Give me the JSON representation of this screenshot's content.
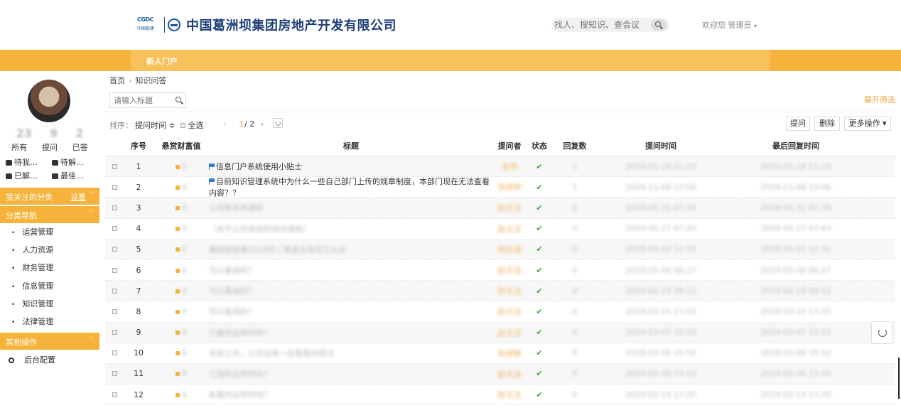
{
  "header": {
    "logo_top": "CGDC",
    "logo_bottom": "中国能建",
    "company": "中国葛洲坝集团房地产开发有限公司",
    "search_placeholder": "找人、搜知识、查会议",
    "welcome": "欢迎您 管理员",
    "caret": "▾"
  },
  "nav": {
    "tab": "新人门户"
  },
  "sidebar": {
    "stats": [
      {
        "num": "23",
        "label": "所有"
      },
      {
        "num": "9",
        "label": "提问"
      },
      {
        "num": "2",
        "label": "已答"
      }
    ],
    "quick": [
      "待我…",
      "待解…",
      "已解…",
      "最佳…"
    ],
    "followed_title": "我关注的分类",
    "followed_action": "设置",
    "category_title": "分类导航",
    "categories": [
      "运营管理",
      "人力资源",
      "财务管理",
      "信息管理",
      "知识管理",
      "法律管理"
    ],
    "other_title": "其他操作",
    "admin": "后台配置",
    "chev": "^"
  },
  "breadcrumb": {
    "home": "首页",
    "sep": "›",
    "current": "知识问答"
  },
  "filter": {
    "placeholder": "请输入标题",
    "expand": "展开筛选"
  },
  "toolbar": {
    "sort_label": "排序：",
    "sort_field": "提问时间 ≑",
    "select_all": "全选",
    "prev": "‹",
    "page_current": "1",
    "page_total": "/ 2",
    "next": "›",
    "ask": "提问",
    "delete": "删除",
    "more": "更多操作 ▾"
  },
  "table": {
    "headers": [
      "序号",
      "悬赏财富值",
      "标题",
      "提问者",
      "状态",
      "回复数",
      "提问时间",
      "最后回复时间"
    ],
    "rows": [
      {
        "no": "1",
        "reward": "0",
        "title": "信息门户系统使用小贴士",
        "flag": true,
        "asker": "张伟",
        "status": "✔",
        "replies": "1",
        "ask_time": "2019-01-18 11:23",
        "last_time": "2019-01-18 11:23"
      },
      {
        "no": "2",
        "reward": "0",
        "title": "目前知识管理系统中为什么一些自己部门上传的规章制度，本部门现在无法查看内容？？",
        "flag": true,
        "asker": "张婷婷",
        "status": "✔",
        "replies": "1",
        "ask_time": "2019-11-08 15:06",
        "last_time": "2019-11-08 15:06"
      },
      {
        "no": "3",
        "reward": "0",
        "title": "公司新系统通知",
        "flag": false,
        "asker": "赵文洁",
        "status": "✔",
        "replies": "0",
        "ask_time": "2019-05-31 07:34",
        "last_time": "2019-05-31 07:34"
      },
      {
        "no": "4",
        "reward": "0",
        "title": "（关于公司系统的培训课程）",
        "flag": false,
        "asker": "赵文洁",
        "status": "✔",
        "replies": "0",
        "ask_time": "2019-05-27 07:43",
        "last_time": "2019-05-27 07:43"
      },
      {
        "no": "5",
        "reward": "0",
        "title": "集团首届第2019年二季度全体员工大会",
        "flag": false,
        "asker": "林云海",
        "status": "✔",
        "replies": "0",
        "ask_time": "2019-05-22 11:31",
        "last_time": "2019-05-22 11:31"
      },
      {
        "no": "6",
        "reward": "0",
        "title": "可以看成的？",
        "flag": false,
        "asker": "赵文洁",
        "status": "✔",
        "replies": "0",
        "ask_time": "2019-05-06 06:27",
        "last_time": "2019-05-06 06:27"
      },
      {
        "no": "7",
        "reward": "0",
        "title": "可以看成的？",
        "flag": false,
        "asker": "赵文洁",
        "status": "✔",
        "replies": "0",
        "ask_time": "2019-04-19 09:12",
        "last_time": "2019-04-19 09:12"
      },
      {
        "no": "8",
        "reward": "0",
        "title": "可以看成的？",
        "flag": false,
        "asker": "赵文洁",
        "status": "✔",
        "replies": "0",
        "ask_time": "2019-03-15 17:55",
        "last_time": "2019-03-15 17:55"
      },
      {
        "no": "9",
        "reward": "0",
        "title": "已看的这样的吗？",
        "flag": false,
        "asker": "赵文洁",
        "status": "✔",
        "replies": "0",
        "ask_time": "2019-03-07 15:33",
        "last_time": "2019-03-07 15:33"
      },
      {
        "no": "10",
        "reward": "0",
        "title": "系统工作，公司日常一些看看的情况",
        "flag": false,
        "asker": "张婷婷",
        "status": "✔",
        "replies": "0",
        "ask_time": "2019-03-06 15:52",
        "last_time": "2019-03-06 15:52"
      },
      {
        "no": "11",
        "reward": "0",
        "title": "工程的这样的吗？",
        "flag": false,
        "asker": "赵文洁",
        "status": "✔",
        "replies": "0",
        "ask_time": "2019-02-26 13:10",
        "last_time": "2019-02-26 13:10"
      },
      {
        "no": "12",
        "reward": "0",
        "title": "新看的这样的吗？",
        "flag": false,
        "asker": "赵文洁",
        "status": "✔",
        "replies": "0",
        "ask_time": "2019-02-14 17:35",
        "last_time": "2019-02-14 17:35"
      }
    ]
  },
  "colors": {
    "accent": "#f5b33b",
    "brand": "#1f3f7a",
    "link": "#f0a640",
    "ok": "#3aa83a"
  }
}
